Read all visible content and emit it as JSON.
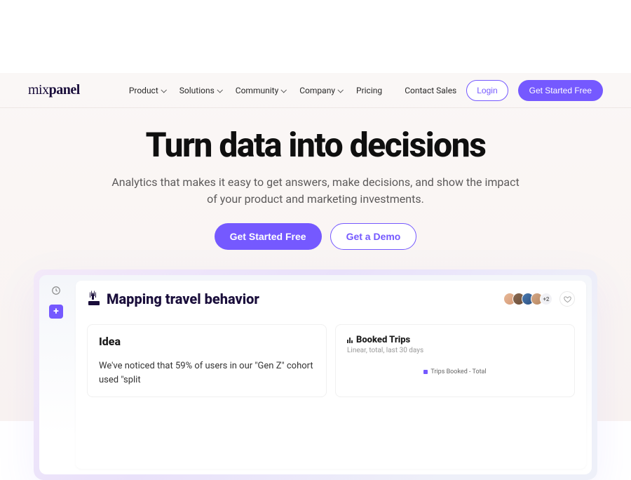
{
  "brand": {
    "part1": "mix",
    "part2": "panel"
  },
  "nav": {
    "items": [
      {
        "label": "Product"
      },
      {
        "label": "Solutions"
      },
      {
        "label": "Community"
      },
      {
        "label": "Company"
      },
      {
        "label": "Pricing"
      }
    ],
    "contact": "Contact Sales",
    "login": "Login",
    "cta": "Get Started Free"
  },
  "hero": {
    "title": "Turn data into decisions",
    "subtitle_line1": "Analytics that makes it easy to get answers, make decisions, and show the impact",
    "subtitle_line2": "of your product and marketing investments.",
    "cta_primary": "Get Started Free",
    "cta_secondary": "Get a Demo"
  },
  "dashboard": {
    "title": "Mapping travel behavior",
    "avatar_overflow": "+2",
    "idea": {
      "title": "Idea",
      "body": "We've noticed that 59% of users in our \"Gen Z\" cohort used \"split"
    },
    "chart": {
      "title": "Booked Trips",
      "subtitle": "Linear, total, last 30 days",
      "legend": "Trips Booked - Total"
    }
  }
}
